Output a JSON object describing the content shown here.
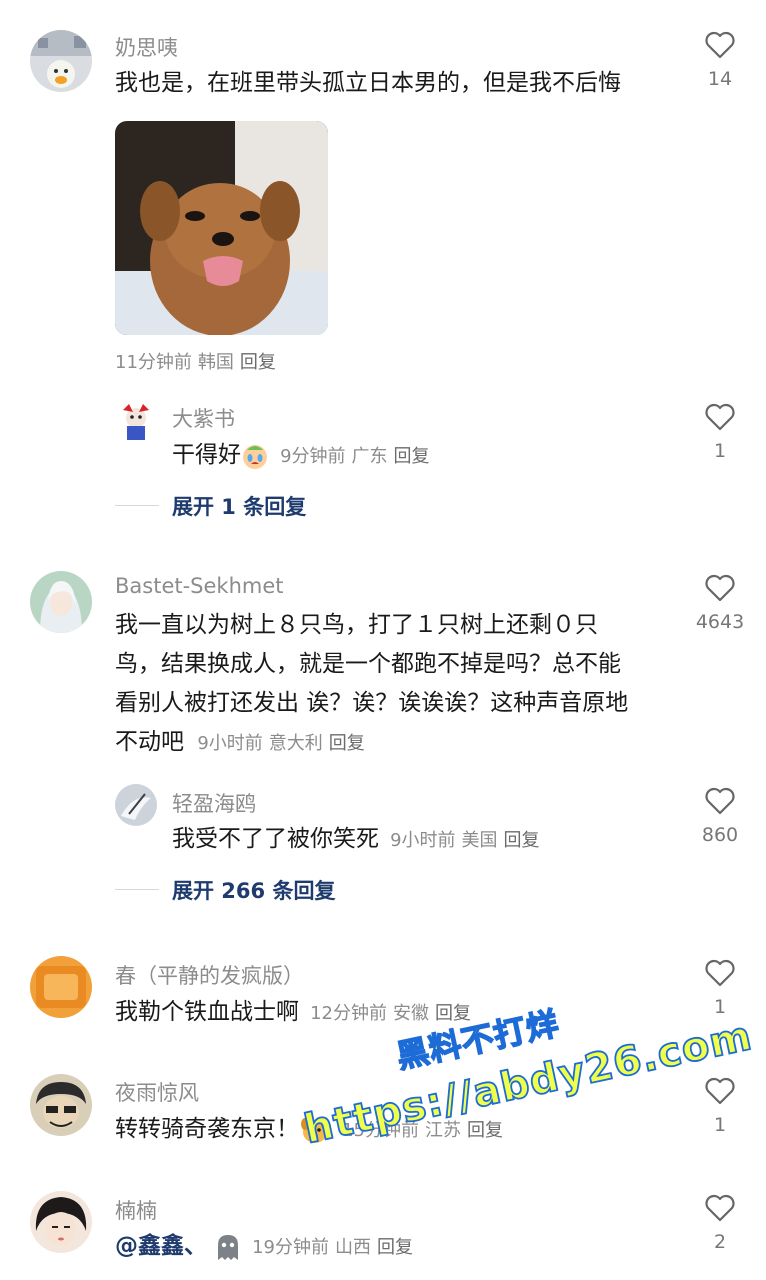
{
  "comments": [
    {
      "username": "奶思咦",
      "text": "我也是，在班里带头孤立日本男的，但是我不后悔",
      "time": "11分钟前",
      "location": "韩国",
      "reply_label": "回复",
      "likes": "14",
      "image_desc": "dog-meme",
      "replies": [
        {
          "username": "大紫书",
          "text": "干得好",
          "time": "9分钟前",
          "location": "广东",
          "reply_label": "回复",
          "likes": "1"
        }
      ],
      "expand_label": "展开 1 条回复"
    },
    {
      "username": "Bastet-Sekhmet",
      "text_lines": [
        "我一直以为树上８只鸟，打了１只树上还剩０只",
        "鸟，结果换成人，就是一个都跑不掉是吗？总不能",
        "看别人被打还发出 诶？诶？诶诶诶？这种声音原地",
        "不动吧"
      ],
      "time": "9小时前",
      "location": "意大利",
      "reply_label": "回复",
      "likes": "4643",
      "replies": [
        {
          "username": "轻盈海鸥",
          "text": "我受不了了被你笑死",
          "time": "9小时前",
          "location": "美国",
          "reply_label": "回复",
          "likes": "860"
        }
      ],
      "expand_label": "展开 266 条回复"
    },
    {
      "username": "春（平静的发疯版）",
      "text": "我勒个铁血战士啊",
      "time": "12分钟前",
      "location": "安徽",
      "reply_label": "回复",
      "likes": "1"
    },
    {
      "username": "夜雨惊风",
      "text": "转转骑奇袭东京！",
      "time": "15分钟前",
      "location": "江苏",
      "reply_label": "回复",
      "likes": "1"
    },
    {
      "username": "楠楠",
      "mention": "@鑫鑫、",
      "time": "19分钟前",
      "location": "山西",
      "reply_label": "回复",
      "likes": "2"
    }
  ],
  "watermark": {
    "line1": "黑料不打烊",
    "line2": "https://abdy26.com"
  },
  "colors": {
    "username": "#8c8c8c",
    "link": "#1f3b6e",
    "text": "#1a1a1a"
  },
  "icons": [
    "heart-icon",
    "crying-emoji-icon",
    "dog-emoji-icon",
    "ghost-emoji-icon"
  ]
}
